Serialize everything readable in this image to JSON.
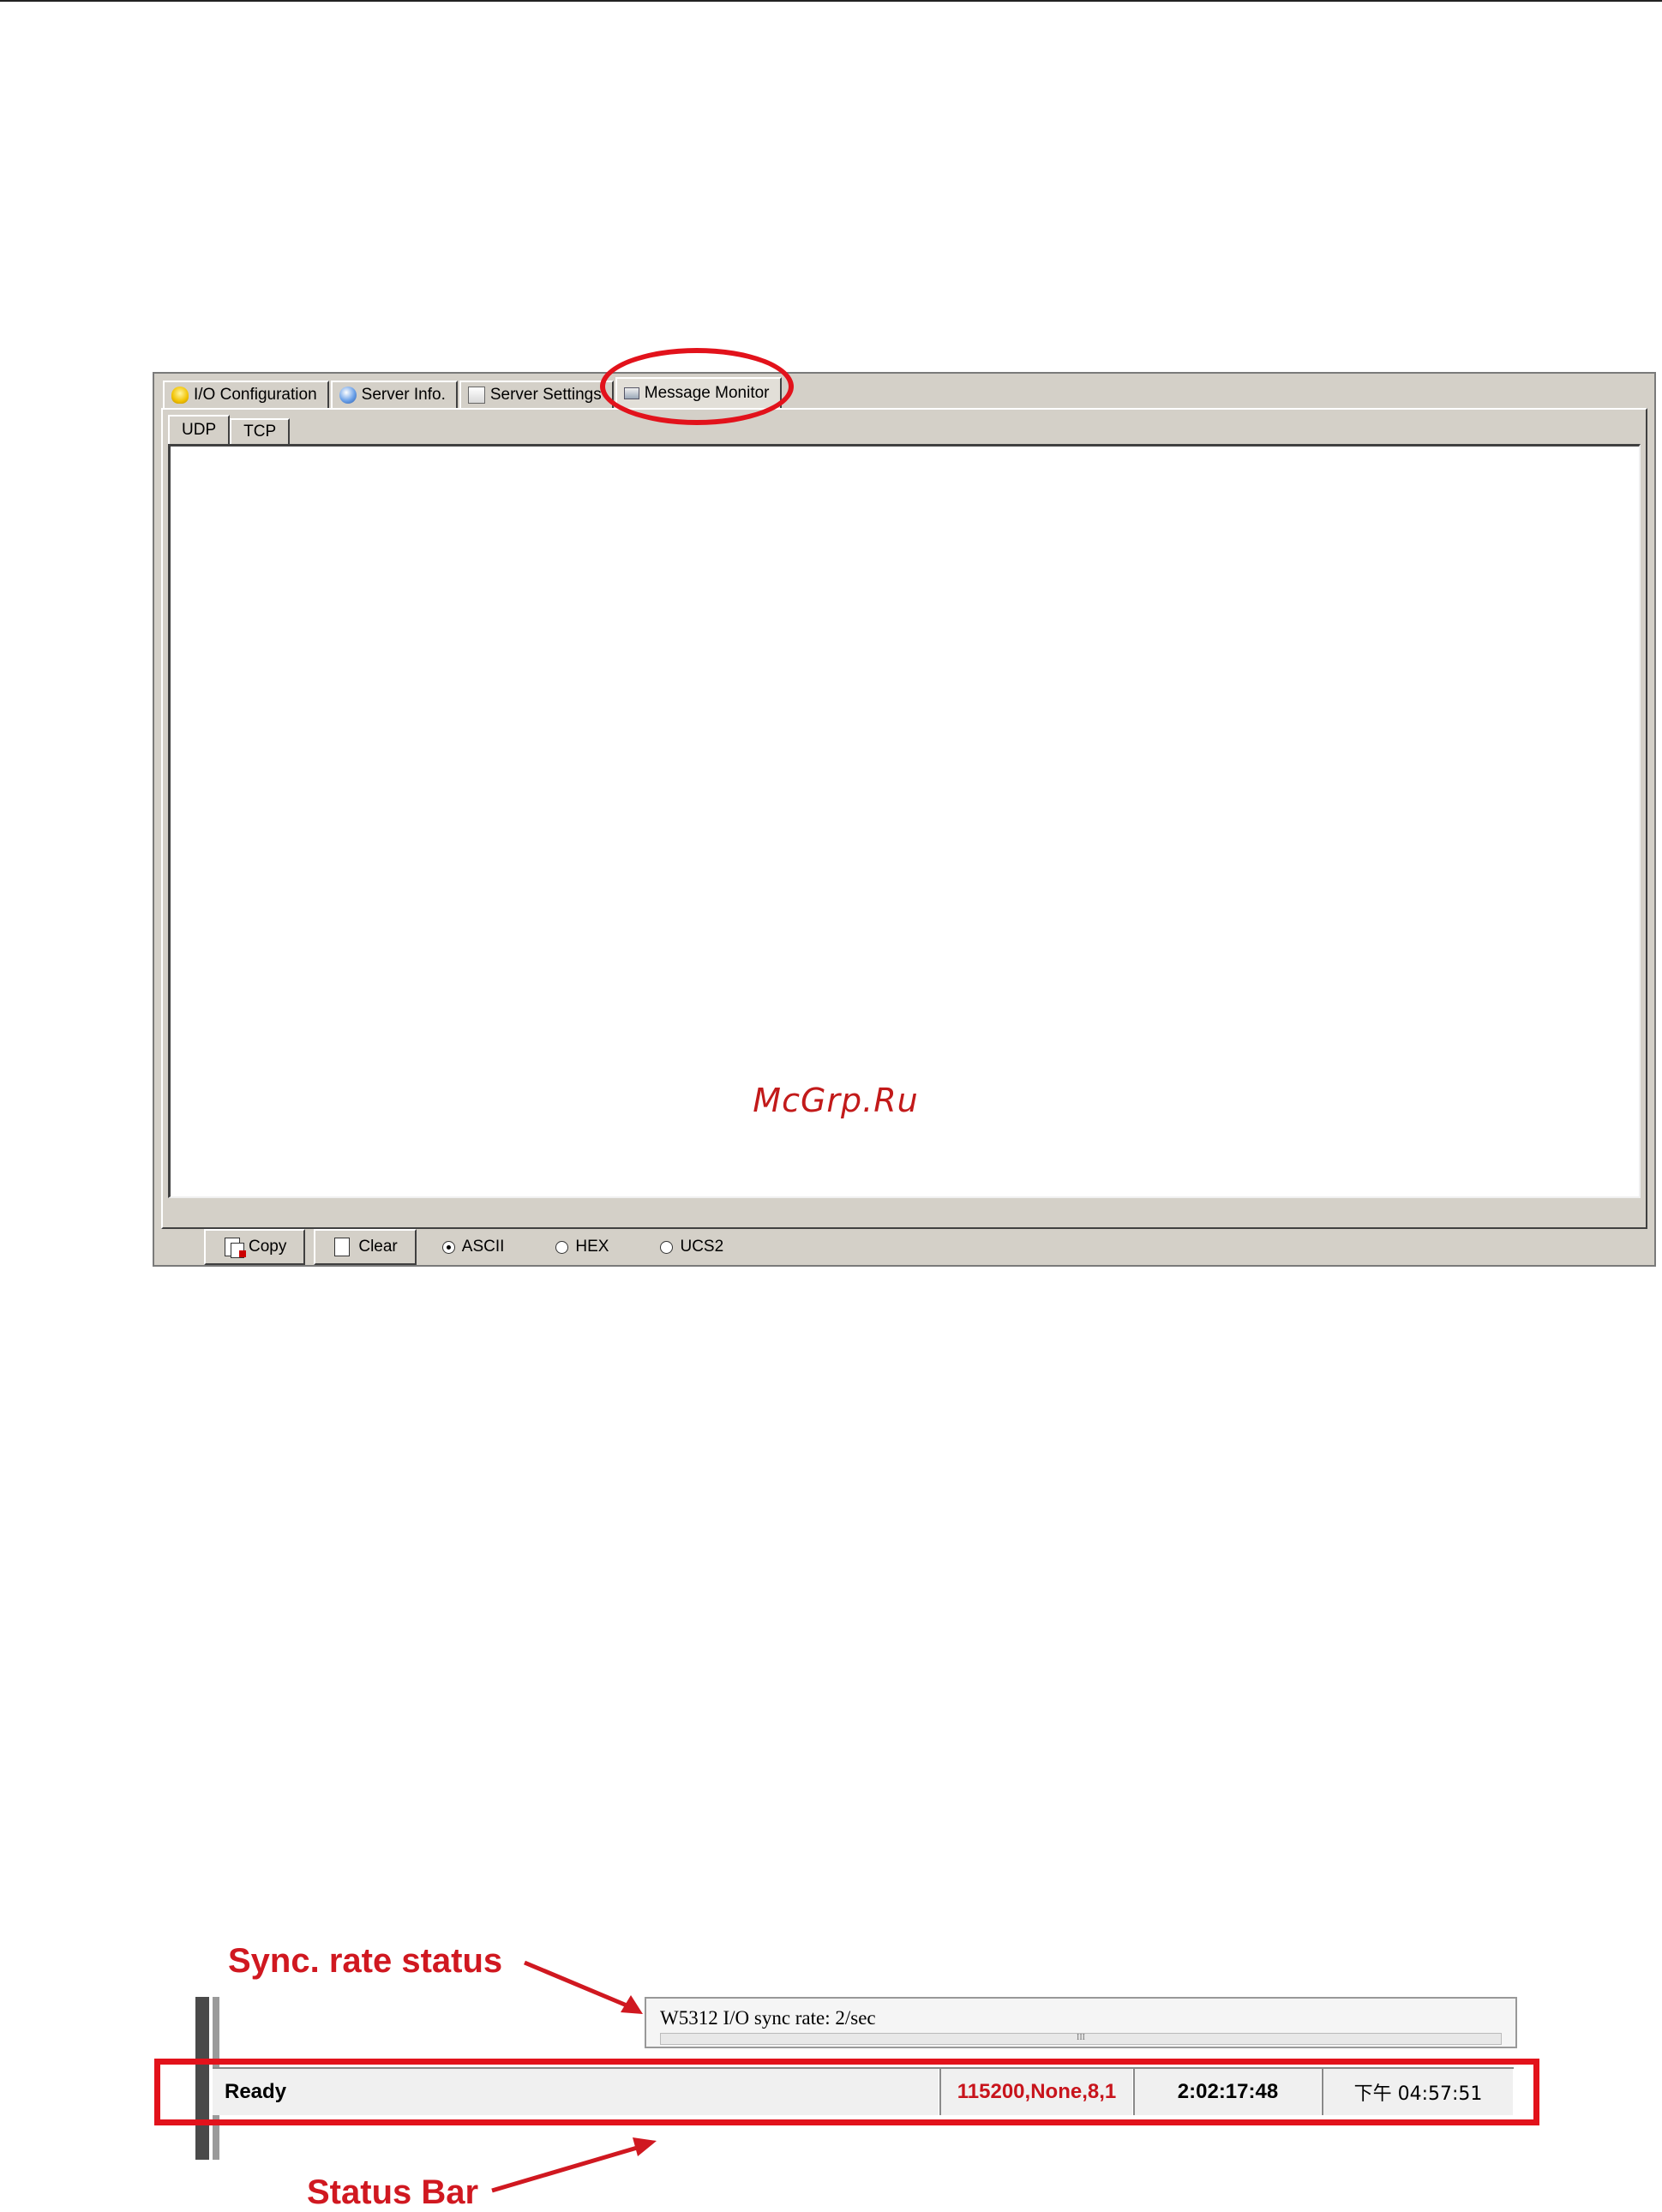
{
  "window": {
    "main_tabs": [
      {
        "label": "I/O Configuration",
        "icon": "lightbulb-icon"
      },
      {
        "label": "Server Info.",
        "icon": "info-icon"
      },
      {
        "label": "Server Settings",
        "icon": "settings-icon"
      },
      {
        "label": "Message Monitor",
        "icon": "monitor-icon",
        "active": true
      }
    ],
    "sub_tabs": [
      {
        "label": "UDP",
        "active": true
      },
      {
        "label": "TCP"
      }
    ],
    "buttons": {
      "copy": "Copy",
      "clear": "Clear"
    },
    "encoding_options": [
      {
        "label": "ASCII",
        "checked": true
      },
      {
        "label": "HEX",
        "checked": false
      },
      {
        "label": "UCS2",
        "checked": false
      }
    ],
    "watermark": "McGrp.Ru"
  },
  "status_section": {
    "sync_label": "Sync. rate status",
    "sync_text": "W5312 I/O sync rate: 2/sec",
    "scroll_grip": "III",
    "status_bar_label": "Status Bar",
    "status_bar": {
      "ready": "Ready",
      "comm_settings": "115200,None,8,1",
      "elapsed": "2:02:17:48",
      "clock": "下午 04:57:51"
    }
  },
  "colors": {
    "annotation_red": "#e2121b",
    "window_gray": "#d4d0c8"
  }
}
